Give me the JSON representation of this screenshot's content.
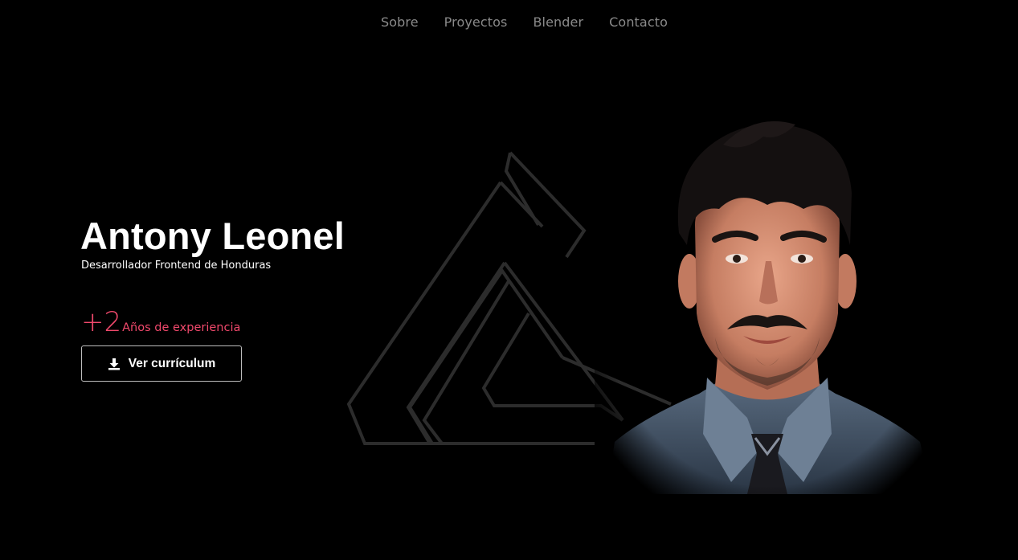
{
  "nav": {
    "items": [
      {
        "label": "Sobre"
      },
      {
        "label": "Proyectos"
      },
      {
        "label": "Blender"
      },
      {
        "label": "Contacto"
      }
    ]
  },
  "hero": {
    "name": "Antony Leonel",
    "subtitle": "Desarrollador Frontend de Honduras",
    "experience_value": "+2",
    "experience_label": "Años de experiencia",
    "cv_button_label": "Ver currículum",
    "cv_button_icon": "download-icon"
  },
  "colors": {
    "background": "#000000",
    "accent": "#f0496c",
    "nav_text": "#8a8a8a",
    "logo_stroke": "#2c2c2c"
  },
  "images": {
    "logo": "triangle-logo",
    "portrait": "profile-portrait"
  }
}
